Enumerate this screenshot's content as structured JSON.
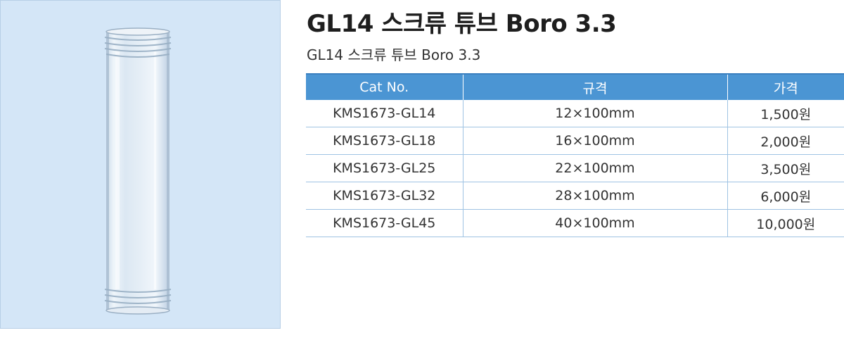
{
  "product": {
    "title": "GL14 스크류 튜브 Boro 3.3",
    "subtitle": "GL14 스크류 튜브 Boro 3.3",
    "image_alt": "glass screw tube"
  },
  "table": {
    "headers": [
      "Cat No.",
      "규격",
      "가격"
    ],
    "rows": [
      {
        "cat_no": "KMS1673-GL14",
        "spec": "12×100mm",
        "price": "1,500원"
      },
      {
        "cat_no": "KMS1673-GL18",
        "spec": "16×100mm",
        "price": "2,000원"
      },
      {
        "cat_no": "KMS1673-GL25",
        "spec": "22×100mm",
        "price": "3,500원"
      },
      {
        "cat_no": "KMS1673-GL32",
        "spec": "28×100mm",
        "price": "6,000원"
      },
      {
        "cat_no": "KMS1673-GL45",
        "spec": "40×100mm",
        "price": "10,000원"
      }
    ]
  },
  "colors": {
    "image_background": "#d4e6f7",
    "header_background": "#4b95d3",
    "row_border": "#9fc3e3"
  }
}
